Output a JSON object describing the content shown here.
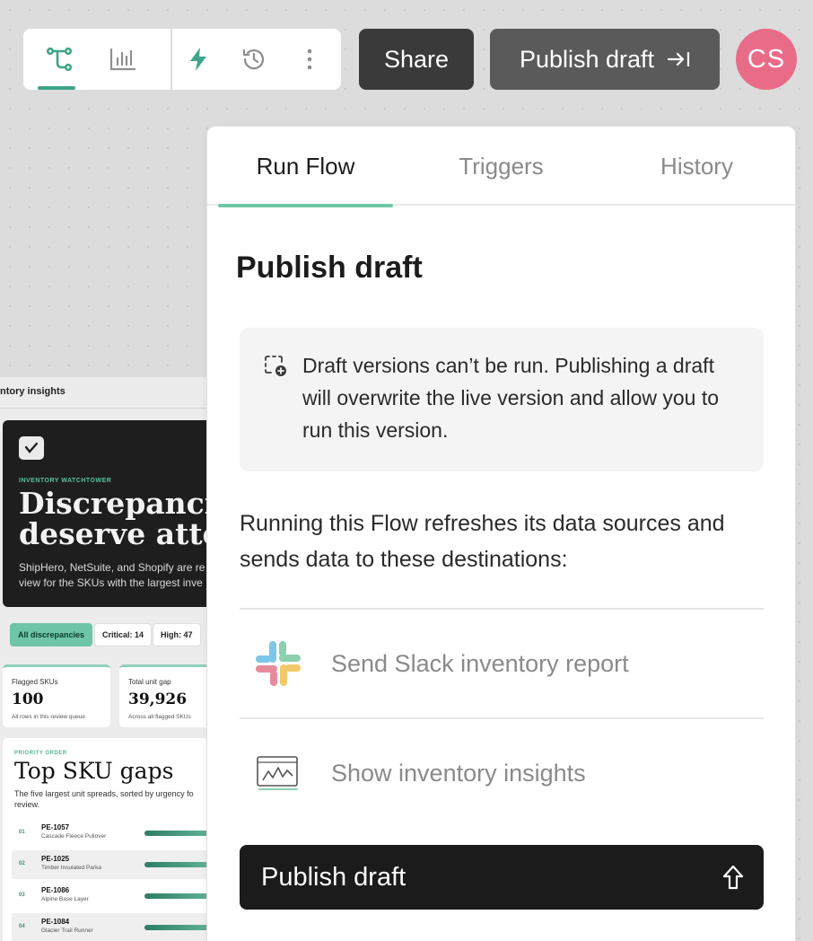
{
  "toolbar": {
    "items": [
      {
        "icon": "flow-branch-icon",
        "active": true
      },
      {
        "icon": "bar-chart-icon",
        "active": false
      },
      {
        "icon": "lightning-icon",
        "active": false
      },
      {
        "icon": "history-icon",
        "active": false
      },
      {
        "icon": "more-vertical-icon",
        "active": false
      }
    ],
    "share_label": "Share",
    "publish_label": "Publish draft",
    "avatar_initials": "CS"
  },
  "colors": {
    "accent": "#3fa58a",
    "tab_underline": "#6fc7a6",
    "avatar": "#e86c88"
  },
  "report": {
    "title": "ntory insights",
    "hero_eyebrow": "INVENTORY WATCHTOWER",
    "hero_title_line1": "Discrepancie",
    "hero_title_line2": "deserve atter",
    "hero_sub_line1": "ShipHero, NetSuite, and Shopify are re",
    "hero_sub_line2": "view for the SKUs with the largest inve",
    "chips": [
      "All discrepancies",
      "Critical: 14",
      "High: 47"
    ],
    "stats": [
      {
        "label": "Flagged SKUs",
        "value": "100",
        "note": "All rows in this review queue"
      },
      {
        "label": "Total unit gap",
        "value": "39,926",
        "note": "Across all flagged SKUs"
      }
    ],
    "gaps_eyebrow": "PRIORITY ORDER",
    "gaps_title": "Top SKU gaps",
    "gaps_desc": "The five largest unit spreads, sorted by urgency fo review.",
    "gap_rows": [
      {
        "rank": "01",
        "sku": "PE-1057",
        "name": "Cascade Fleece Pullover"
      },
      {
        "rank": "02",
        "sku": "PE-1025",
        "name": "Timber Insulated Parka"
      },
      {
        "rank": "03",
        "sku": "PE-1086",
        "name": "Alpine Base Layer"
      },
      {
        "rank": "04",
        "sku": "PE-1084",
        "name": "Glacier Trail Runner"
      }
    ]
  },
  "panel": {
    "tabs": [
      "Run Flow",
      "Triggers",
      "History"
    ],
    "active_tab": "Run Flow",
    "title": "Publish draft",
    "notice": "Draft versions can’t be run. Publishing a draft will overwrite the live version and allow you to run this version.",
    "intro": "Running this Flow refreshes its data sources and sends data to these destinations:",
    "destinations": [
      {
        "icon": "slack-icon",
        "label": "Send Slack inventory report"
      },
      {
        "icon": "dashboard-chart-icon",
        "label": "Show inventory insights"
      }
    ],
    "publish_button": "Publish draft"
  }
}
